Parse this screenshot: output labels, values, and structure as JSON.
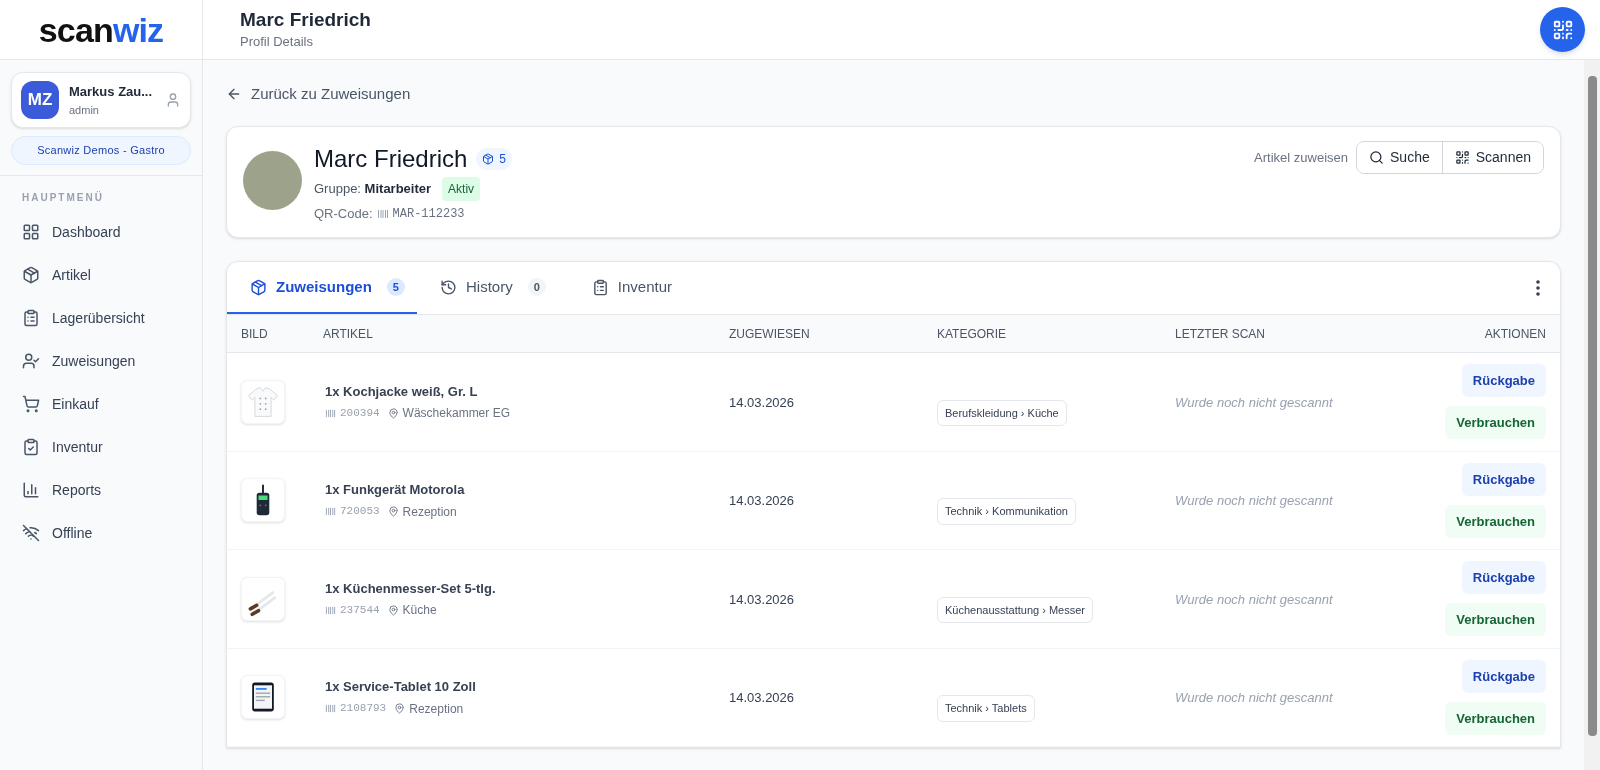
{
  "logo": {
    "part_1": "scan",
    "part_2": "wiz"
  },
  "user": {
    "initials": "MZ",
    "name": "Markus Zau...",
    "role": "admin"
  },
  "organization": "Scanwiz Demos - Gastro",
  "sidebar": {
    "heading": "HAUPTMENÜ",
    "items": [
      {
        "label": "Dashboard",
        "kind": "dashboard",
        "selected": false
      },
      {
        "label": "Artikel",
        "kind": "box",
        "selected": false
      },
      {
        "label": "Lagerübersicht",
        "kind": "clipboard",
        "selected": false
      },
      {
        "label": "Zuweisungen",
        "kind": "user-check",
        "selected": false
      },
      {
        "label": "Einkauf",
        "kind": "cart",
        "selected": false
      },
      {
        "label": "Inventur",
        "kind": "clipboard-check",
        "selected": false
      },
      {
        "label": "Reports",
        "kind": "chart",
        "selected": false
      },
      {
        "label": "Offline",
        "kind": "wifi-off",
        "selected": false
      }
    ]
  },
  "header": {
    "title": "Marc Friedrich",
    "subtitle": "Profil Details"
  },
  "back_link": "Zurück zu Zuweisungen",
  "profile": {
    "name": "Marc Friedrich",
    "item_count": "5",
    "group_label": "Gruppe:",
    "group": "Mitarbeiter",
    "status": "Aktiv",
    "qr_label": "QR-Code:",
    "qr_code": "MAR-112233",
    "assign_label": "Artikel zuweisen",
    "buttons": [
      {
        "label": "Suche",
        "kind": "search"
      },
      {
        "label": "Scannen",
        "kind": "qr"
      }
    ]
  },
  "tabs": [
    {
      "label": "Zuweisungen",
      "kind": "box",
      "count": "5",
      "selected": true
    },
    {
      "label": "History",
      "kind": "history",
      "count": "0",
      "selected": false
    },
    {
      "label": "Inventur",
      "kind": "clipboard",
      "selected": false
    }
  ],
  "table": {
    "columns": [
      "BILD",
      "ARTIKEL",
      "ZUGEWIESEN",
      "KATEGORIE",
      "LETZTER SCAN",
      "AKTIONEN"
    ],
    "rows": [
      {
        "kind": "jacket",
        "name": "1x Kochjacke weiß, Gr. L",
        "code": "200394",
        "location": "Wäschekammer EG",
        "date": "14.03.2026",
        "category": "Berufskleidung › Küche",
        "last_scan": "Wurde noch nicht gescannt",
        "actions": [
          "Rückgabe",
          "Verbrauchen"
        ]
      },
      {
        "kind": "radio",
        "name": "1x Funkgerät Motorola",
        "code": "720053",
        "location": "Rezeption",
        "date": "14.03.2026",
        "category": "Technik › Kommunikation",
        "last_scan": "Wurde noch nicht gescannt",
        "actions": [
          "Rückgabe",
          "Verbrauchen"
        ]
      },
      {
        "kind": "knives",
        "name": "1x Küchenmesser-Set 5-tlg.",
        "code": "237544",
        "location": "Küche",
        "date": "14.03.2026",
        "category": "Küchenausstattung › Messer",
        "last_scan": "Wurde noch nicht gescannt",
        "actions": [
          "Rückgabe",
          "Verbrauchen"
        ]
      },
      {
        "kind": "tablet",
        "name": "1x Service-Tablet 10 Zoll",
        "code": "2108793",
        "location": "Rezeption",
        "date": "14.03.2026",
        "category": "Technik › Tablets",
        "last_scan": "Wurde noch nicht gescannt",
        "actions": [
          "Rückgabe",
          "Verbrauchen"
        ]
      }
    ]
  }
}
